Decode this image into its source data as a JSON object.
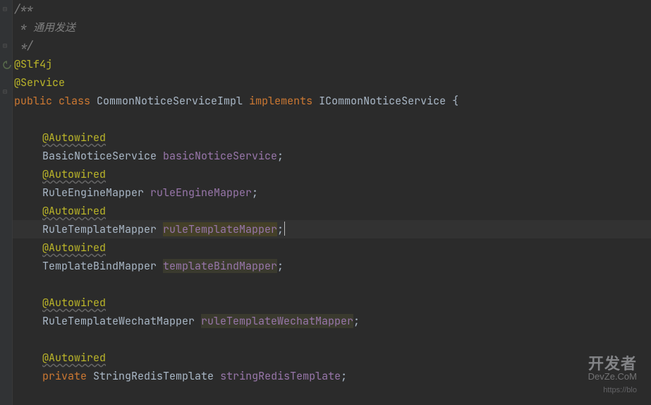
{
  "colors": {
    "background": "#2b2b2b",
    "foreground": "#a9b7c6",
    "comment": "#808080",
    "annotation": "#bbb529",
    "keyword": "#cc7832",
    "field": "#9876aa",
    "highlight_bg": "#444028",
    "gutter": "#313335"
  },
  "comment": {
    "open": "/**",
    "body": " * 通用发送",
    "close": " */"
  },
  "annotations": {
    "slf4j": "@Slf4j",
    "service": "@Service",
    "autowired": "@Autowired"
  },
  "class_decl": {
    "modifiers": "public class",
    "name": "CommonNoticeServiceImpl",
    "implements_kw": "implements",
    "iface": "ICommonNoticeService",
    "brace": "{"
  },
  "fields": {
    "f1_type": "BasicNoticeService",
    "f1_name": "basicNoticeService",
    "f2_type": "RuleEngineMapper",
    "f2_name": "ruleEngineMapper",
    "f3_type": "RuleTemplateMapper",
    "f3_name": "ruleTemplateMapper",
    "f4_type": "TemplateBindMapper",
    "f4_name": "templateBindMapper",
    "f5_type": "RuleTemplateWechatMapper",
    "f5_name": "ruleTemplateWechatMapper",
    "f6_modifier": "private",
    "f6_type": "StringRedisTemplate",
    "f6_name": "stringRedisTemplate",
    "semi": ";"
  },
  "watermark": {
    "brand": "开发者",
    "sub1": "DevZe.CoM",
    "sub2": "https://blo"
  }
}
